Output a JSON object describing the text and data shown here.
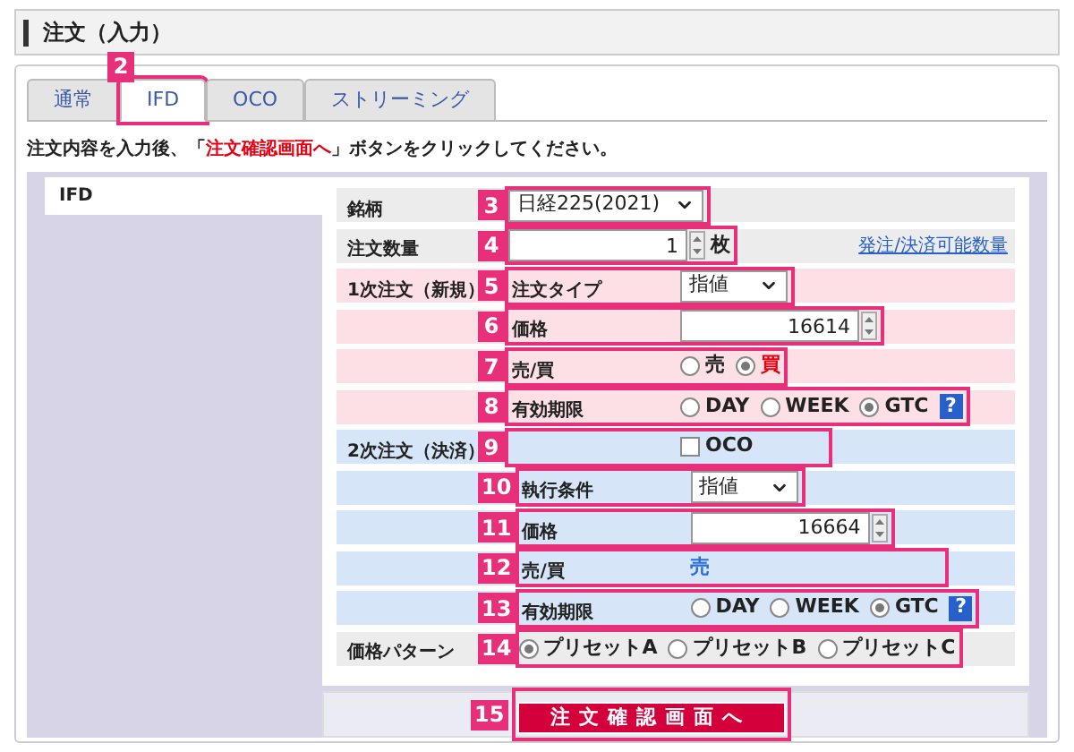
{
  "title": "注文（入力）",
  "tabs": [
    {
      "label": "通常",
      "selected": false
    },
    {
      "label": "IFD",
      "selected": true,
      "callout": "2"
    },
    {
      "label": "OCO",
      "selected": false
    },
    {
      "label": "ストリーミング",
      "selected": false
    }
  ],
  "instruction": "注文内容を入力後、「**注文確認画面へ**」ボタンをクリックしてください。",
  "side_label": "IFD",
  "rows": [
    {
      "color": "#ececec",
      "group": "銘柄",
      "callout": "3",
      "kind": "select",
      "value": "日経225(2021)"
    },
    {
      "color": "#ececec",
      "group": "注文数量",
      "callout": "4",
      "kind": "number",
      "value": "1",
      "unit": "枚",
      "link": "発注/決済可能数量"
    },
    {
      "color": "#fde0e5",
      "group": "1次注文（新規）",
      "callout": "5",
      "label": "注文タイプ",
      "kind": "select",
      "value": "指値"
    },
    {
      "color": "#fde0e5",
      "callout": "6",
      "label": "価格",
      "kind": "number",
      "value": "16614"
    },
    {
      "color": "#fde0e5",
      "callout": "7",
      "label": "売/買",
      "kind": "radio",
      "options": [
        {
          "label": "売",
          "selected": false
        },
        {
          "label": "買",
          "selected": true,
          "color": "#e60012"
        }
      ]
    },
    {
      "color": "#fde0e5",
      "callout": "8",
      "label": "有効期限",
      "kind": "radio",
      "options": [
        {
          "label": "DAY",
          "selected": false
        },
        {
          "label": "WEEK",
          "selected": false
        },
        {
          "label": "GTC",
          "selected": true
        }
      ],
      "help": "?"
    },
    {
      "color": "#d6e6f8",
      "group": "2次注文（決済）",
      "callout": "9",
      "kind": "checkbox",
      "check_label": "OCO",
      "checked": false
    },
    {
      "color": "#d6e6f8",
      "callout": "10",
      "label": "執行条件",
      "kind": "select",
      "value": "指値"
    },
    {
      "color": "#d6e6f8",
      "callout": "11",
      "label": "価格",
      "kind": "number",
      "value": "16664"
    },
    {
      "color": "#d6e6f8",
      "callout": "12",
      "label": "売/買",
      "kind": "text",
      "value": "売"
    },
    {
      "color": "#d6e6f8",
      "callout": "13",
      "label": "有効期限",
      "kind": "radio",
      "options": [
        {
          "label": "DAY",
          "selected": false
        },
        {
          "label": "WEEK",
          "selected": false
        },
        {
          "label": "GTC",
          "selected": true
        }
      ],
      "help": "?"
    },
    {
      "color": "#ececec",
      "group": "価格パターン",
      "callout": "14",
      "kind": "radio",
      "options": [
        {
          "label": "プリセットA",
          "selected": true
        },
        {
          "label": "プリセットB",
          "selected": false
        },
        {
          "label": "プリセットC",
          "selected": false
        }
      ]
    }
  ],
  "submit": {
    "label": "注文確認画面へ",
    "callout": "15"
  }
}
